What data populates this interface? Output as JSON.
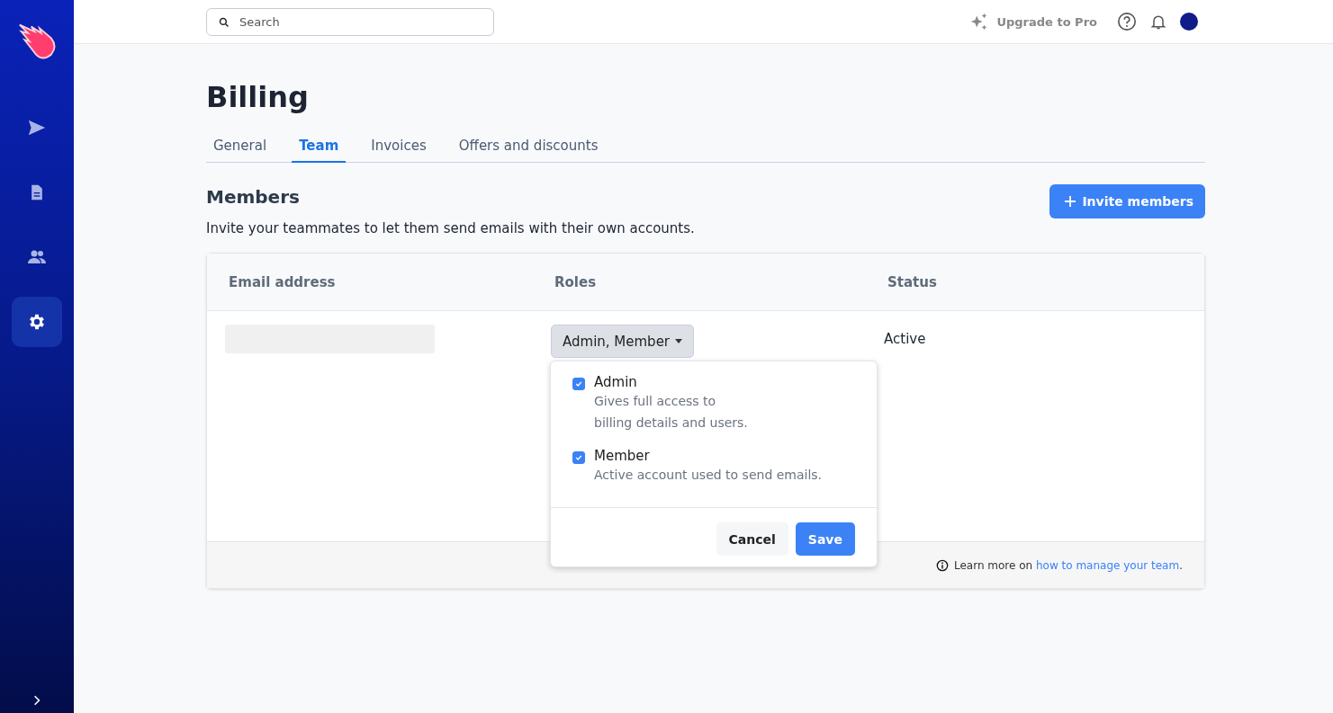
{
  "sidebar": {
    "items": [
      {
        "kind": "send",
        "selected": false
      },
      {
        "kind": "document",
        "selected": false
      },
      {
        "kind": "people",
        "selected": false
      },
      {
        "kind": "settings",
        "selected": true
      }
    ]
  },
  "topbar": {
    "search": {
      "placeholder": "Search"
    },
    "upgrade": "Upgrade to Pro"
  },
  "page": {
    "title": "Billing"
  },
  "tabs": [
    {
      "label": "General",
      "selected": false
    },
    {
      "label": "Team",
      "selected": true
    },
    {
      "label": "Invoices",
      "selected": false
    },
    {
      "label": "Offers and discounts",
      "selected": false
    }
  ],
  "members": {
    "title": "Members",
    "description": "Invite your teammates to let them send emails with their own accounts.",
    "invite_button": "Invite members"
  },
  "table": {
    "columns": [
      "Email address",
      "Roles",
      "Status"
    ],
    "rows": [
      {
        "roles": "Admin, Member",
        "status": "Active"
      }
    ]
  },
  "roles_menu": {
    "open": true,
    "options": [
      {
        "label": "Admin",
        "description": "Gives full access to\nbilling details and users.",
        "checked": true
      },
      {
        "label": "Member",
        "description": "Active account used to send emails.",
        "checked": true
      }
    ],
    "cancel": "Cancel",
    "save": "Save"
  },
  "footer": {
    "text": "Learn more on ",
    "link": "how to manage your team",
    "end": "."
  }
}
